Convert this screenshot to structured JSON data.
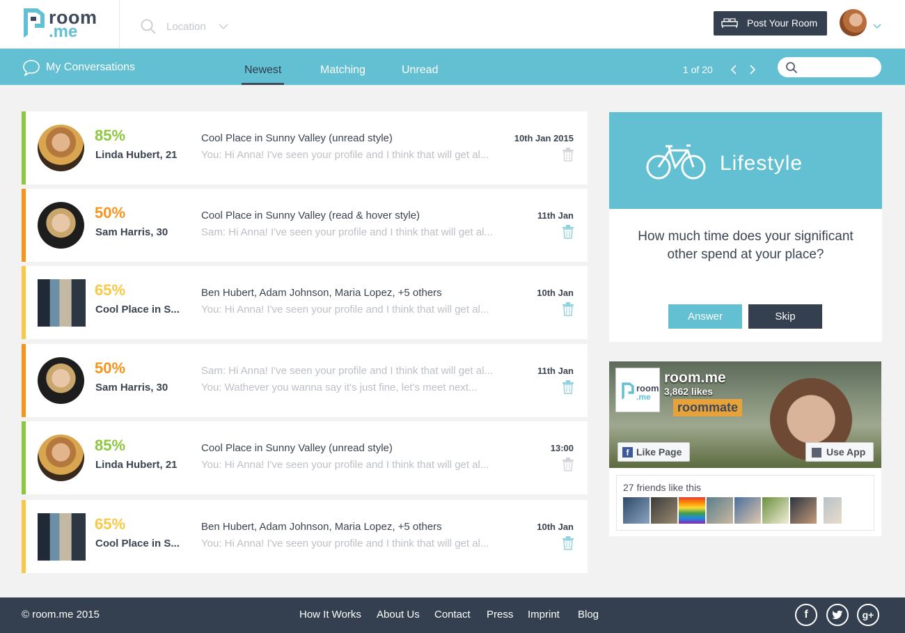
{
  "header": {
    "logo_line1": "room",
    "logo_line2": ".me",
    "location_placeholder": "Location",
    "post_room_label": "Post Your Room"
  },
  "subnav": {
    "title": "My Conversations",
    "tabs": [
      "Newest",
      "Matching",
      "Unread"
    ],
    "active_tab": "Newest",
    "pager": "1 of 20"
  },
  "conversations": [
    {
      "match": "85%",
      "match_color": "#8dc63f",
      "stripe": "#8dc63f",
      "name": "Linda Hubert, 21",
      "subject": "Cool Place in Sunny Valley (unread style)",
      "preview": "You: Hi Anna! I've seen your profile and I think that will get al...",
      "date": "10th Jan 2015",
      "photo": "woman"
    },
    {
      "match": "50%",
      "match_color": "#f7941d",
      "stripe": "#f7941d",
      "name": "Sam Harris, 30",
      "subject": "Cool Place in Sunny Valley (read & hover style)",
      "preview": "Sam: Hi Anna! I've seen your profile and I think that will get al...",
      "date": "11th Jan",
      "photo": "man"
    },
    {
      "match": "65%",
      "match_color": "#f9c846",
      "stripe": "#f9c846",
      "name": "Cool Place in S...",
      "subject": "Ben Hubert, Adam Johnson, Maria Lopez, +5 others",
      "preview": "You: Hi Anna! I've seen your profile and I think that will get al...",
      "date": "10th Jan",
      "photo": "room"
    },
    {
      "match": "50%",
      "match_color": "#f7941d",
      "stripe": "#f7941d",
      "name": "Sam Harris, 30",
      "subject": "Sam: Hi Anna! I've seen your profile and I think that will get al...",
      "preview": "You: Wathever you wanna say it's just fine, let's meet next...",
      "date": "11th Jan",
      "photo": "man"
    },
    {
      "match": "85%",
      "match_color": "#8dc63f",
      "stripe": "#8dc63f",
      "name": "Linda Hubert, 21",
      "subject": "Cool Place in Sunny Valley (unread style)",
      "preview": "You: Hi Anna! I've seen your profile and I think that will get al...",
      "date": "13:00",
      "photo": "woman"
    },
    {
      "match": "65%",
      "match_color": "#f9c846",
      "stripe": "#f9c846",
      "name": "Cool Place in S...",
      "subject": "Ben Hubert, Adam Johnson, Maria Lopez, +5 others",
      "preview": "You: Hi Anna! I've seen your profile and I think that will get al...",
      "date": "10th Jan",
      "photo": "room"
    }
  ],
  "lifestyle": {
    "title": "Lifestyle",
    "question": "How much time does your significant other spend at your place?",
    "answer_label": "Answer",
    "skip_label": "Skip"
  },
  "facebook": {
    "page_name": "room.me",
    "likes": "3,862 likes",
    "banner_word": "roommate",
    "like_page_label": "Like Page",
    "use_app_label": "Use App",
    "friends_text": "27 friends like this"
  },
  "footer": {
    "copyright": "© room.me 2015",
    "links": [
      "How It Works",
      "About Us",
      "Contact",
      "Press",
      "Imprint",
      "Blog"
    ],
    "social": [
      "facebook-icon",
      "twitter-icon",
      "google-plus-icon"
    ]
  },
  "colors": {
    "accent": "#62c0d2",
    "dark": "#343f4f"
  }
}
